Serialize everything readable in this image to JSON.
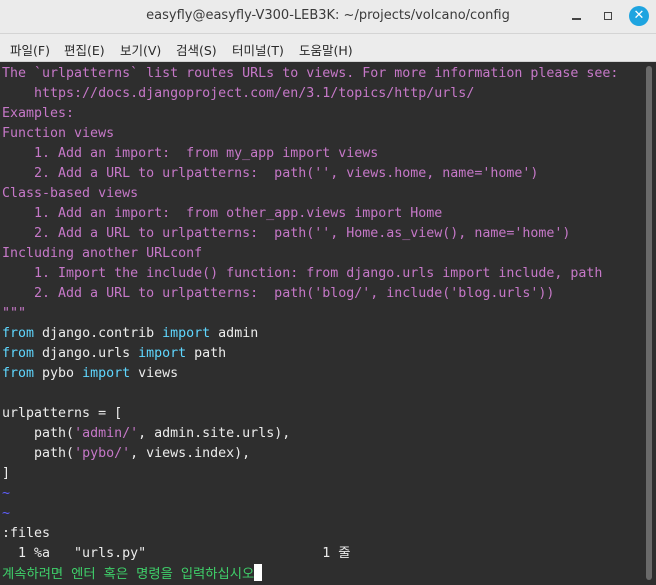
{
  "window": {
    "title": "easyfly@easyfly-V300-LEB3K: ~/projects/volcano/config",
    "close_glyph": "✕"
  },
  "menu": [
    "파일(F)",
    "편집(E)",
    "보기(V)",
    "검색(S)",
    "터미널(T)",
    "도움말(H)"
  ],
  "editor": {
    "doc": [
      "The `urlpatterns` list routes URLs to views. For more information please see:",
      "    https://docs.djangoproject.com/en/3.1/topics/http/urls/",
      "Examples:",
      "Function views",
      "    1. Add an import:  from my_app import views",
      "    2. Add a URL to urlpatterns:  path('', views.home, name='home')",
      "Class-based views",
      "    1. Add an import:  from other_app.views import Home",
      "    2. Add a URL to urlpatterns:  path('', Home.as_view(), name='home')",
      "Including another URLconf",
      "    1. Import the include() function: from django.urls import include, path",
      "    2. Add a URL to urlpatterns:  path('blog/', include('blog.urls'))",
      "\"\"\""
    ],
    "imports": [
      {
        "kw1": "from",
        "mod": " django.contrib ",
        "kw2": "import",
        "name": " admin"
      },
      {
        "kw1": "from",
        "mod": " django.urls ",
        "kw2": "import",
        "name": " path"
      },
      {
        "kw1": "from",
        "mod": " pybo ",
        "kw2": "import",
        "name": " views"
      }
    ],
    "urlpatterns_open": "urlpatterns = [",
    "path1": {
      "pre": "    path(",
      "str": "'admin/'",
      "post": ", admin.site.urls),"
    },
    "path2": {
      "pre": "    path(",
      "str": "'pybo/'",
      "post": ", views.index),"
    },
    "close_bracket": "]",
    "tilde": "~",
    "command": ":files",
    "buffer_line": "  1 %a   \"urls.py\"                      1 줄",
    "prompt": "계속하려면 엔터 혹은 명령을 입력하십시오"
  }
}
